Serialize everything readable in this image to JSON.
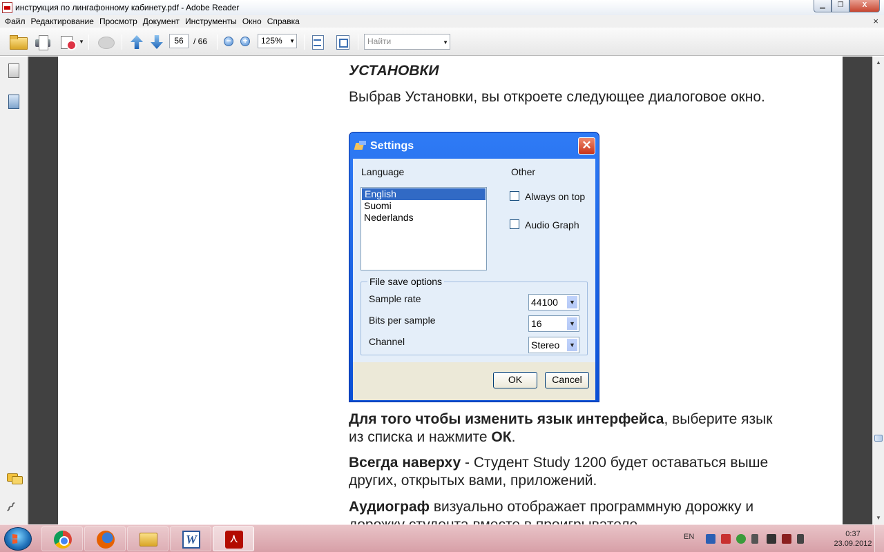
{
  "window": {
    "title": "инструкция по лингафонному кабинету.pdf - Adobe Reader",
    "minimize": "▁",
    "maximize": "❐",
    "close": "X"
  },
  "menu": {
    "items": [
      "Файл",
      "Редактирование",
      "Просмотр",
      "Документ",
      "Инструменты",
      "Окно",
      "Справка"
    ],
    "close_glyph": "×"
  },
  "toolbar": {
    "current_page": "56",
    "total_pages": "/ 66",
    "zoom_out_glyph": "−",
    "zoom_in_glyph": "+",
    "zoom": "125%",
    "find_placeholder": "Найти",
    "dropdown_glyph": "▼"
  },
  "document": {
    "heading": "УСТАНОВКИ",
    "intro": "Выбрав Установки, вы откроете следующее диалоговое окно.",
    "para_language_bold": "Для того чтобы изменить язык интерфейса",
    "para_language_rest": ", выберите язык из списка и нажмите ",
    "para_language_ok": "ОК",
    "para_language_end": ".",
    "para_ontop_bold": "Всегда наверху",
    "para_ontop_rest": " - Студент Study 1200 будет оставаться выше других, открытых вами, приложений.",
    "para_audio_bold": "Аудиограф",
    "para_audio_rest": " визуально отображает программную дорожку и дорожку студента вместе в проигрывателе."
  },
  "dialog": {
    "title": "Settings",
    "close_glyph": "✕",
    "language_label": "Language",
    "languages": [
      "English",
      "Suomi",
      "Nederlands"
    ],
    "selected_language": "English",
    "other_label": "Other",
    "always_on_top": "Always on top",
    "audio_graph": "Audio Graph",
    "file_save_options": "File save options",
    "sample_rate_label": "Sample rate",
    "sample_rate": "44100",
    "bits_label": "Bits per sample",
    "bits": "16",
    "channel_label": "Channel",
    "channel": "Stereo",
    "ok": "OK",
    "cancel": "Cancel"
  },
  "taskbar": {
    "language": "EN",
    "time": "0:37",
    "date": "23.09.2012"
  }
}
